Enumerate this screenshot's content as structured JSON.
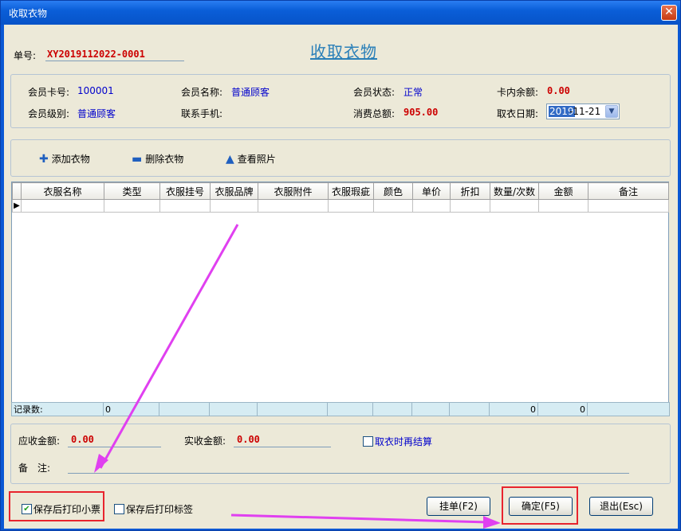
{
  "window": {
    "title": "收取衣物",
    "close_glyph": "✕"
  },
  "heading": "收取衣物",
  "order": {
    "label": "单号:",
    "value": "XY2019112022-0001"
  },
  "member": {
    "card_no_label": "会员卡号:",
    "card_no": "100001",
    "name_label": "会员名称:",
    "name": "普通顾客",
    "status_label": "会员状态:",
    "status": "正常",
    "balance_label": "卡内余额:",
    "balance": "0.00",
    "level_label": "会员级别:",
    "level": "普通顾客",
    "phone_label": "联系手机:",
    "phone": "",
    "total_label": "消费总额:",
    "total": "905.00",
    "date_label": "取衣日期:",
    "date_selected": "2019",
    "date_rest": "-11-21"
  },
  "toolbar": {
    "add": "添加衣物",
    "delete": "删除衣物",
    "photo": "查看照片"
  },
  "grid": {
    "columns": [
      "衣服名称",
      "类型",
      "衣服挂号",
      "衣服品牌",
      "衣服附件",
      "衣服瑕疵",
      "颜色",
      "单价",
      "折扣",
      "数量/次数",
      "金额",
      "备注"
    ],
    "footer": {
      "label": "记录数:",
      "count": "0",
      "qty_total": "0",
      "amount_total": "0"
    }
  },
  "totals": {
    "receivable_label": "应收金额:",
    "receivable": "0.00",
    "received_label": "实收金额:",
    "received": "0.00",
    "settle_label": "取衣时再结算",
    "remark_label": "备　注:"
  },
  "options": {
    "print_receipt": "保存后打印小票",
    "print_label": "保存后打印标签"
  },
  "buttons": {
    "hold": "挂单(F2)",
    "confirm": "确定(F5)",
    "exit": "退出(Esc)"
  },
  "colors": {
    "accent_red": "#e8242e",
    "arrow": "#e040f0"
  }
}
